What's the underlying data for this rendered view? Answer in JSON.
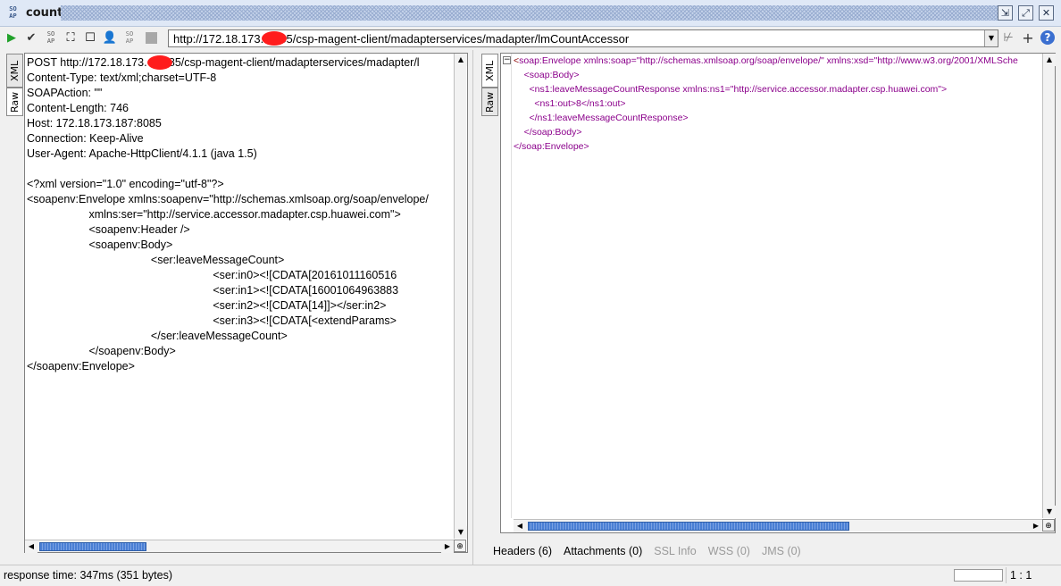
{
  "window": {
    "title": "count",
    "logo_text": "SO AP"
  },
  "toolbar": {
    "url": "http://172.18.173.   8085/csp-magent-client/madapterservices/madapter/lmCountAccessor"
  },
  "request": {
    "tabs": [
      "XML",
      "Raw"
    ],
    "active_tab": "Raw",
    "lines": [
      "POST http://172.18.173.   8085/csp-magent-client/madapterservices/madapter/l",
      "Content-Type: text/xml;charset=UTF-8",
      "SOAPAction: \"\"",
      "Content-Length: 746",
      "Host: 172.18.173.187:8085",
      "Connection: Keep-Alive",
      "User-Agent: Apache-HttpClient/4.1.1 (java 1.5)",
      "",
      "<?xml version=\"1.0\" encoding=\"utf-8\"?>",
      "<soapenv:Envelope xmlns:soapenv=\"http://schemas.xmlsoap.org/soap/envelope/",
      "                    xmlns:ser=\"http://service.accessor.madapter.csp.huawei.com\">",
      "                    <soapenv:Header />",
      "                    <soapenv:Body>",
      "                                        <ser:leaveMessageCount>",
      "                                                            <ser:in0><![CDATA[20161011160516",
      "                                                            <ser:in1><![CDATA[16001064963883",
      "                                                            <ser:in2><![CDATA[14]]></ser:in2>",
      "                                                            <ser:in3><![CDATA[<extendParams>",
      "                                        </ser:leaveMessageCount>",
      "                    </soapenv:Body>",
      "</soapenv:Envelope>"
    ]
  },
  "response": {
    "tabs": [
      "XML",
      "Raw"
    ],
    "active_tab": "XML",
    "lines": [
      "<soap:Envelope xmlns:soap=\"http://schemas.xmlsoap.org/soap/envelope/\" xmlns:xsd=\"http://www.w3.org/2001/XMLSche",
      "    <soap:Body>",
      "      <ns1:leaveMessageCountResponse xmlns:ns1=\"http://service.accessor.madapter.csp.huawei.com\">",
      "        <ns1:out>8</ns1:out>",
      "      </ns1:leaveMessageCountResponse>",
      "    </soap:Body>",
      "</soap:Envelope>"
    ]
  },
  "bottom_tabs": [
    {
      "label": "Headers (6)",
      "enabled": true
    },
    {
      "label": "Attachments (0)",
      "enabled": true
    },
    {
      "label": "SSL Info",
      "enabled": false
    },
    {
      "label": "WSS (0)",
      "enabled": false
    },
    {
      "label": "JMS (0)",
      "enabled": false
    }
  ],
  "status": {
    "response_time": "response time: 347ms (351 bytes)",
    "cursor_position": "1 : 1"
  },
  "colors": {
    "redaction": "#ff1c1c",
    "scroll_thumb": "#4a7fd4",
    "run_icon": "#21a12a"
  }
}
